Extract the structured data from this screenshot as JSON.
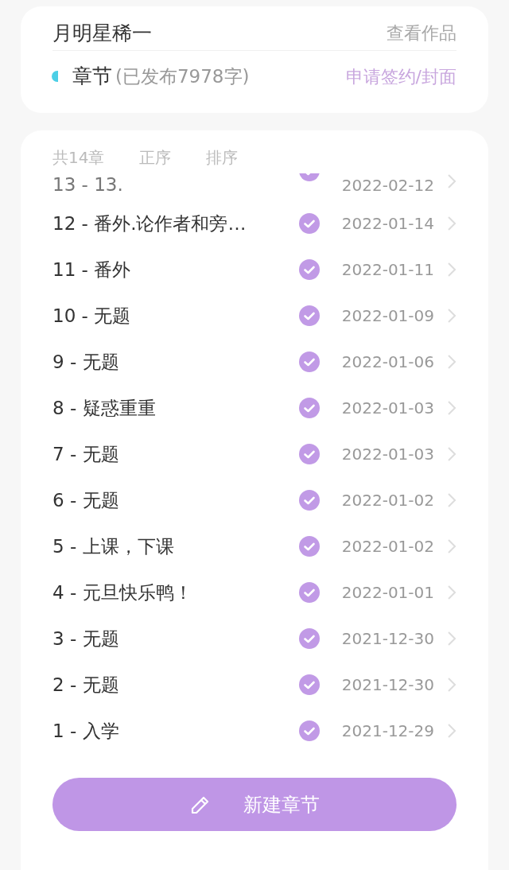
{
  "header": {
    "author": "月明星稀一",
    "view_works": "查看作品",
    "section_title": "章节",
    "section_note": "(已发布7978字)",
    "apply_link": "申请签约/封面"
  },
  "toolbar": [
    "共14章",
    "正序",
    "排序"
  ],
  "chapters": [
    {
      "title": "13 - 13.",
      "published": true,
      "date": "2022-02-12"
    },
    {
      "title": "12 - 番外.论作者和旁…",
      "published": true,
      "date": "2022-01-14"
    },
    {
      "title": "11 - 番外",
      "published": true,
      "date": "2022-01-11"
    },
    {
      "title": "10 - 无题",
      "published": true,
      "date": "2022-01-09"
    },
    {
      "title": "9 - 无题",
      "published": true,
      "date": "2022-01-06"
    },
    {
      "title": "8 - 疑惑重重",
      "published": true,
      "date": "2022-01-03"
    },
    {
      "title": "7 - 无题",
      "published": true,
      "date": "2022-01-03"
    },
    {
      "title": "6 - 无题",
      "published": true,
      "date": "2022-01-02"
    },
    {
      "title": "5 - 上课，下课",
      "published": true,
      "date": "2022-01-02"
    },
    {
      "title": "4 - 元旦快乐鸭！",
      "published": true,
      "date": "2022-01-01"
    },
    {
      "title": "3 - 无题",
      "published": true,
      "date": "2021-12-30"
    },
    {
      "title": "2 - 无题",
      "published": true,
      "date": "2021-12-30"
    },
    {
      "title": "1 - 入学",
      "published": true,
      "date": "2021-12-29"
    }
  ],
  "new_button": "新建章节"
}
